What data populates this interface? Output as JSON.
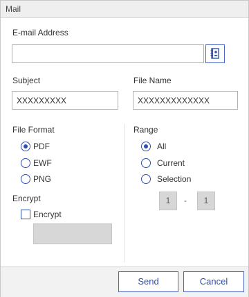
{
  "window": {
    "title": "Mail"
  },
  "email": {
    "label": "E-mail Address",
    "value": "",
    "address_book_icon": "address-book-icon"
  },
  "subject": {
    "label": "Subject",
    "value": "XXXXXXXXX"
  },
  "file_name": {
    "label": "File Name",
    "value": "XXXXXXXXXXXXX"
  },
  "file_format": {
    "label": "File Format",
    "options": [
      {
        "label": "PDF",
        "selected": true
      },
      {
        "label": "EWF",
        "selected": false
      },
      {
        "label": "PNG",
        "selected": false
      }
    ]
  },
  "encrypt": {
    "label": "Encrypt",
    "checkbox_label": "Encrypt",
    "checked": false,
    "password_value": ""
  },
  "range": {
    "label": "Range",
    "options": [
      {
        "label": "All",
        "selected": true
      },
      {
        "label": "Current",
        "selected": false
      },
      {
        "label": "Selection",
        "selected": false
      }
    ],
    "from": "1",
    "separator": "-",
    "to": "1"
  },
  "buttons": {
    "send": "Send",
    "cancel": "Cancel"
  },
  "colors": {
    "accent": "#2f4fae",
    "button_border": "#4a67c7",
    "disabled": "#d7d7d7"
  }
}
